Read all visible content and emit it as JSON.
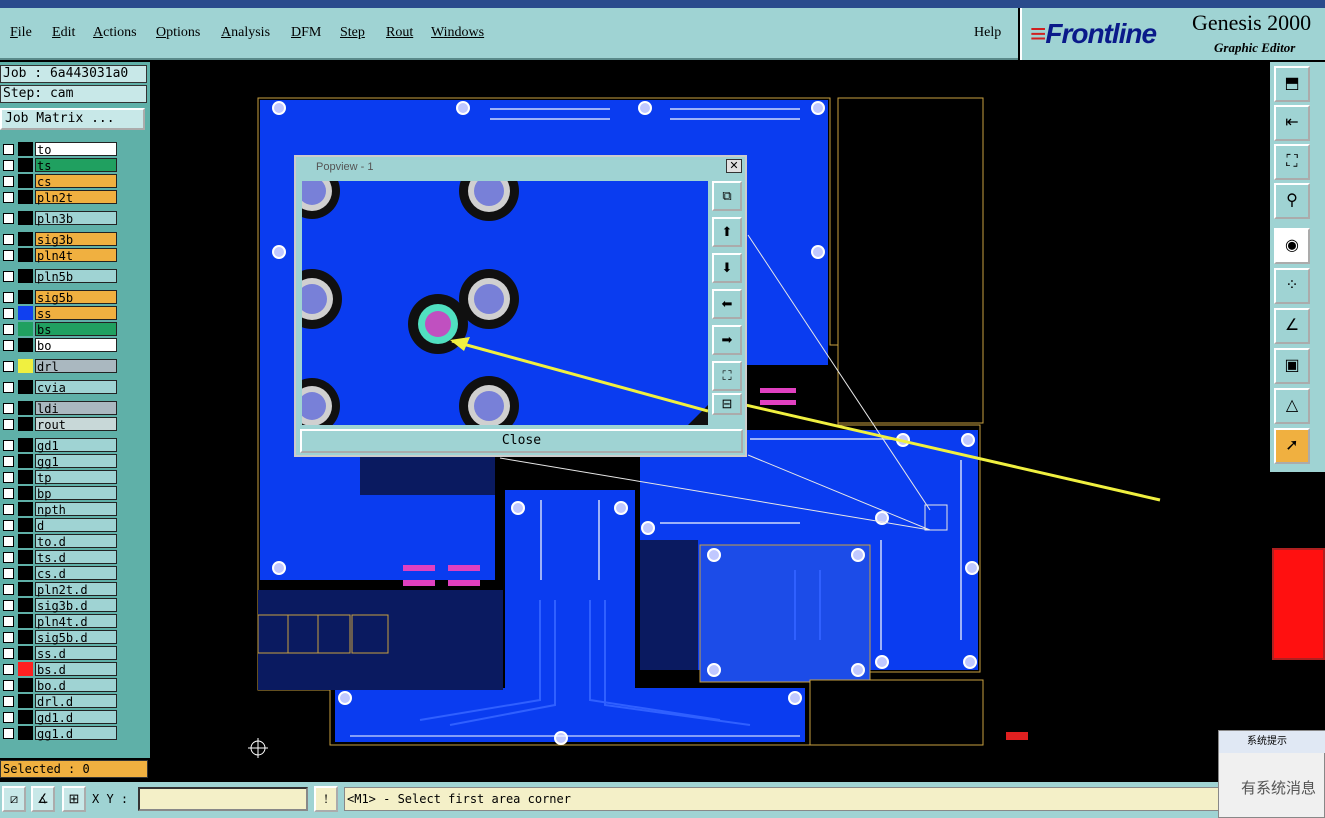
{
  "menu": {
    "items": [
      "File",
      "Edit",
      "Actions",
      "Options",
      "Analysis",
      "DFM",
      "Step",
      "Rout",
      "Windows"
    ],
    "help": "Help"
  },
  "brand": {
    "logo": "Frontline",
    "title": "Genesis 2000",
    "subtitle": "Graphic Editor"
  },
  "job": {
    "job_line": "Job : 6a443031a0",
    "step_line": "Step: cam",
    "matrix_button": "Job Matrix ..."
  },
  "layers": [
    {
      "name": "to",
      "color": "#ffffff"
    },
    {
      "name": "ts",
      "color": "#20a060"
    },
    {
      "name": "cs",
      "color": "#f0b040"
    },
    {
      "name": "pln2t",
      "color": "#f0b040"
    },
    {
      "name": "pln3b",
      "color": "#9fd3d3"
    },
    {
      "name": "sig3b",
      "color": "#f0b040"
    },
    {
      "name": "pln4t",
      "color": "#f0b040"
    },
    {
      "name": "pln5b",
      "color": "#9fd3d3"
    },
    {
      "name": "sig5b",
      "color": "#f0b040"
    },
    {
      "name": "ss",
      "color": "#f0b040"
    },
    {
      "name": "bs",
      "color": "#20a060"
    },
    {
      "name": "bo",
      "color": "#ffffff"
    },
    {
      "name": "drl",
      "color": "#aab8c0"
    },
    {
      "name": "cvia",
      "color": "#9fd3d3"
    },
    {
      "name": "ldi",
      "color": "#aab8c0"
    },
    {
      "name": "rout",
      "color": "#c8d8d8"
    },
    {
      "name": "gd1",
      "color": "#9fd3d3"
    },
    {
      "name": "gg1",
      "color": "#9fd3d3"
    },
    {
      "name": "tp",
      "color": "#9fd3d3"
    },
    {
      "name": "bp",
      "color": "#9fd3d3"
    },
    {
      "name": "npth",
      "color": "#9fd3d3"
    },
    {
      "name": "d",
      "color": "#9fd3d3"
    },
    {
      "name": "to.d",
      "color": "#9fd3d3"
    },
    {
      "name": "ts.d",
      "color": "#9fd3d3"
    },
    {
      "name": "cs.d",
      "color": "#9fd3d3"
    },
    {
      "name": "pln2t.d",
      "color": "#9fd3d3"
    },
    {
      "name": "sig3b.d",
      "color": "#9fd3d3"
    },
    {
      "name": "pln4t.d",
      "color": "#9fd3d3"
    },
    {
      "name": "sig5b.d",
      "color": "#9fd3d3"
    },
    {
      "name": "ss.d",
      "color": "#9fd3d3"
    },
    {
      "name": "bs.d",
      "color": "#9fd3d3"
    },
    {
      "name": "bo.d",
      "color": "#9fd3d3"
    },
    {
      "name": "drl.d",
      "color": "#9fd3d3"
    },
    {
      "name": "gd1.d",
      "color": "#9fd3d3"
    },
    {
      "name": "gg1.d",
      "color": "#9fd3d3"
    }
  ],
  "status": {
    "selected": "Selected : 0"
  },
  "bottom": {
    "xy_label": "X Y :",
    "xy_value": "",
    "prompt": "<M1> - Select first area corner"
  },
  "popview": {
    "title": "Popview - 1",
    "close_label": "Close"
  },
  "notice": {
    "title": "系统提示",
    "body": "有系统消息"
  }
}
